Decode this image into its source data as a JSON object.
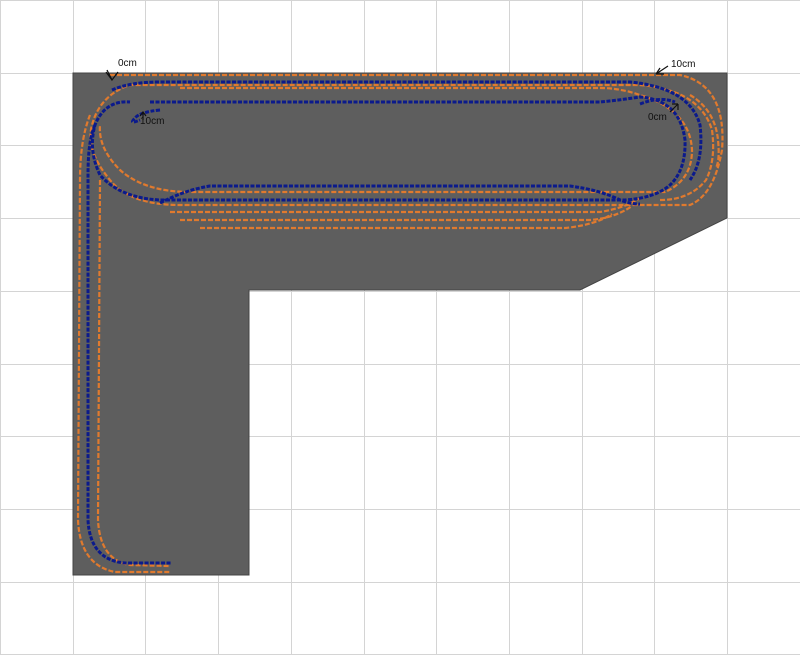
{
  "colors": {
    "background": "#ffffff",
    "grid": "#d4d4d4",
    "board": "#5e5e5e",
    "track_outer": "#e07a2e",
    "track_inner": "#0b1a8c"
  },
  "grid": {
    "visible": true
  },
  "markers": [
    {
      "label": "0cm",
      "icon": "arrow-marker-icon"
    },
    {
      "label": "10cm",
      "icon": "arrow-marker-icon"
    },
    {
      "label": "10cm",
      "icon": "arrow-marker-icon"
    },
    {
      "label": "0cm",
      "icon": "arrow-marker-icon"
    }
  ]
}
